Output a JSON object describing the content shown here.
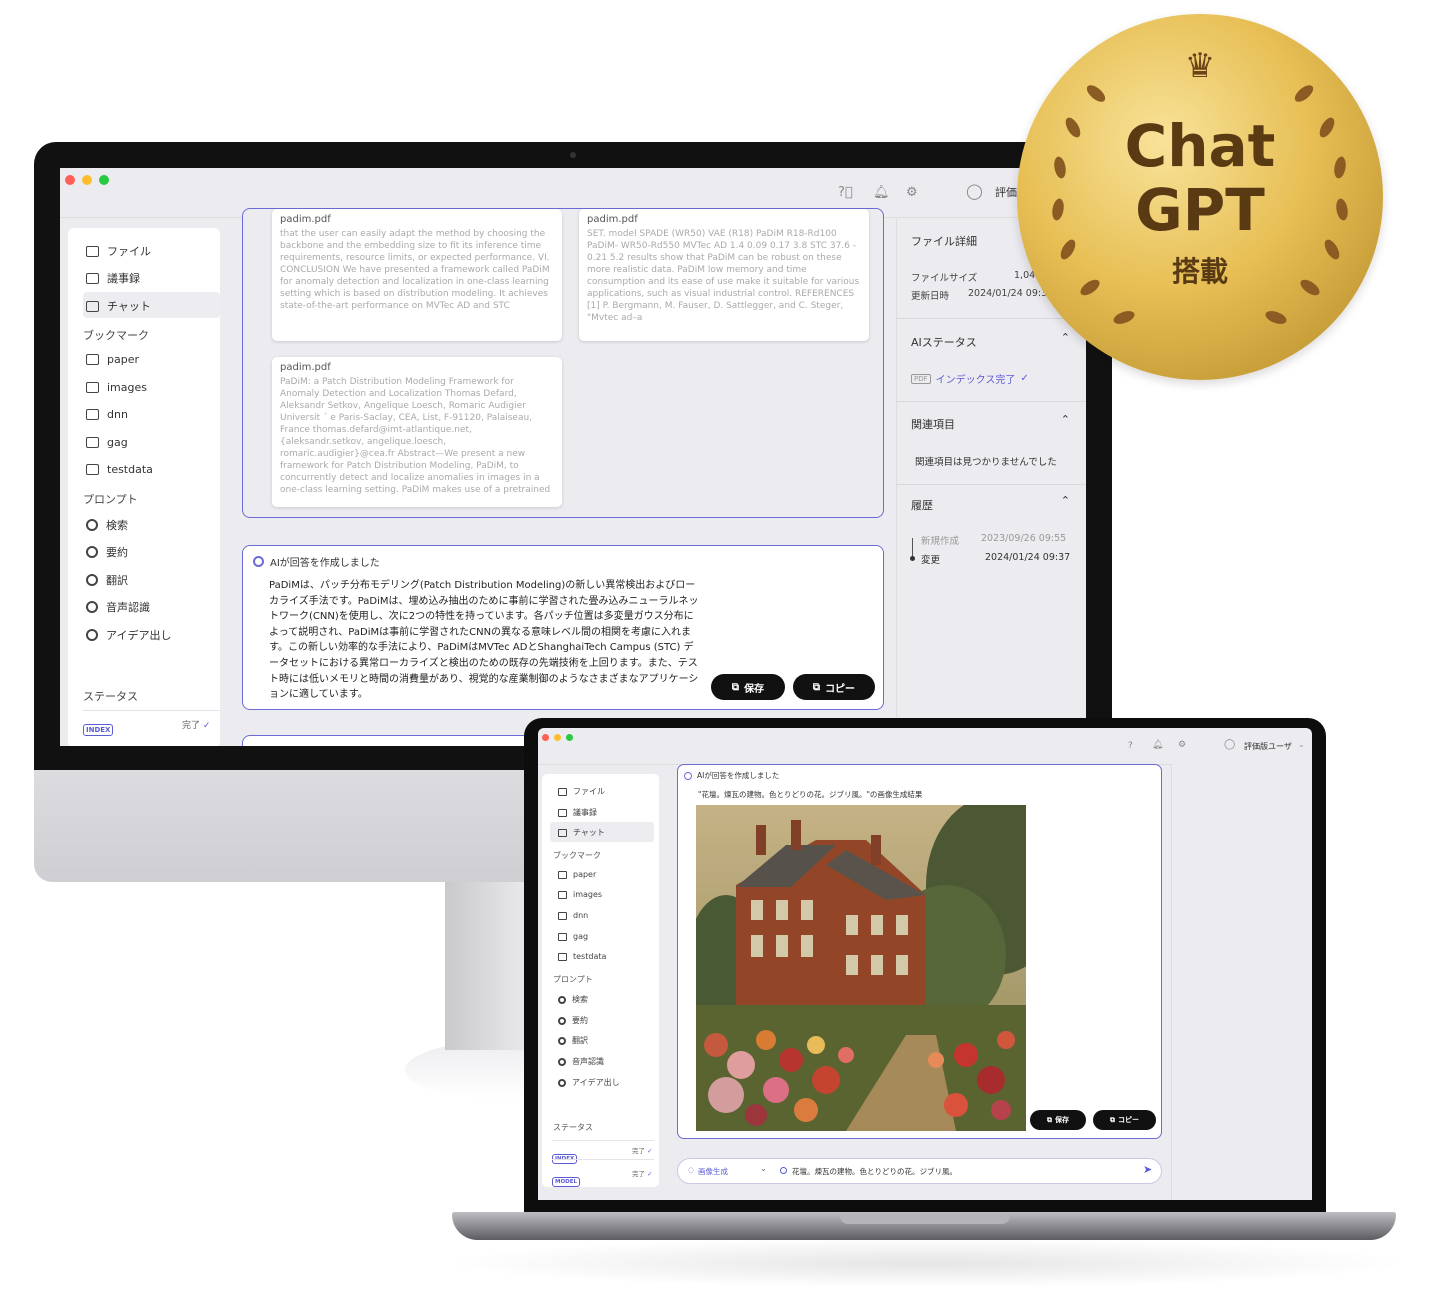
{
  "desktop": {
    "topbar": {
      "user_label": "評価版"
    },
    "sidebar": {
      "items": [
        {
          "label": "ファイル"
        },
        {
          "label": "議事録"
        },
        {
          "label": "チャット"
        }
      ],
      "bookmarks_heading": "ブックマーク",
      "bookmarks": [
        {
          "label": "paper"
        },
        {
          "label": "images"
        },
        {
          "label": "dnn"
        },
        {
          "label": "gag"
        },
        {
          "label": "testdata"
        }
      ],
      "prompts_heading": "プロンプト",
      "prompts": [
        {
          "label": "検索"
        },
        {
          "label": "要約"
        },
        {
          "label": "翻訳"
        },
        {
          "label": "音声認識"
        },
        {
          "label": "アイデア出し"
        }
      ],
      "status_heading": "ステータス",
      "status_index_badge": "INDEX",
      "status_index_value": "完了"
    },
    "results": [
      {
        "title": "padim.pdf",
        "text": "that the user can easily adapt the method by choosing the backbone and the embedding size to fit its inference time requirements, resource limits, or expected performance. VI. CONCLUSION We have presented a framework called PaDiM for anomaly detection and localization in one-class learning setting which is based on distribution modeling. It achieves state-of-the-art performance on MVTec AD and STC"
      },
      {
        "title": "padim.pdf",
        "text": "SET. model SPADE (WR50) VAE (R18) PaDiM R18-Rd100 PaDiM- WR50-Rd550 MVTec AD 1.4 0.09 0.17 3.8 STC 37.6 - 0.21 5.2 results show that PaDiM can be robust on these more realistic data. PaDiM low memory and time consumption and its ease of use make it suitable for various applications, such as visual industrial control. REFERENCES [1] P. Bergmann, M. Fauser, D. Sattlegger, and C. Steger, \"Mvtec ad–a"
      },
      {
        "title": "padim.pdf",
        "text": "PaDiM: a Patch Distribution Modeling Framework for Anomaly Detection and Localization Thomas Defard, Aleksandr Setkov, Angelique Loesch, Romaric Audigier Universit ´ e Paris-Saclay, CEA, List, F-91120, Palaiseau, France thomas.defard@imt-atlantique.net, {aleksandr.setkov, angelique.loesch, romaric.audigier}@cea.fr Abstract—We present a new framework for Patch Distribution Modeling, PaDiM, to concurrently detect and localize anomalies in images in a one-class learning setting. PaDiM makes use of a pretrained"
      }
    ],
    "answer": {
      "heading": "AIが回答を作成しました",
      "body": "PaDiMは、パッチ分布モデリング(Patch Distribution Modeling)の新しい異常検出およびローカライズ手法です。PaDiMは、埋め込み抽出のために事前に学習された畳み込みニューラルネットワーク(CNN)を使用し、次に2つの特性を持っています。各パッチ位置は多変量ガウス分布によって説明され、PaDiMは事前に学習されたCNNの異なる意味レベル間の相関を考慮に入れます。この新しい効率的な手法により、PaDiMはMVTec ADとShanghaiTech Campus (STC) データセットにおける異常ローカライズと検出のための既存の先端技術を上回ります。また、テスト時には低いメモリと時間の消費量があり、視覚的な産業制御のようなさまざまなアプリケーションに適しています。",
      "save_label": "保存",
      "copy_label": "コピー"
    },
    "right_panel": {
      "file_details_heading": "ファイル詳細",
      "file_size_label": "ファイルサイズ",
      "file_size_value": "1,04",
      "updated_label": "更新日時",
      "updated_value": "2024/01/24 09:3",
      "ai_status_heading": "AIステータス",
      "pdf_badge": "PDF",
      "index_status": "インデックス完了",
      "related_heading": "関連項目",
      "related_empty": "関連項目は見つかりませんでした",
      "history_heading": "履歴",
      "history": [
        {
          "label": "新規作成",
          "date": "2023/09/26 09:55"
        },
        {
          "label": "変更",
          "date": "2024/01/24 09:37"
        }
      ]
    }
  },
  "badge": {
    "line1": "Chat",
    "line2": "GPT",
    "line3": "搭載"
  },
  "laptop": {
    "topbar": {
      "user_label": "評価版ユーザ"
    },
    "sidebar": {
      "items": [
        {
          "label": "ファイル"
        },
        {
          "label": "議事録"
        },
        {
          "label": "チャット"
        }
      ],
      "bookmarks_heading": "ブックマーク",
      "bookmarks": [
        {
          "label": "paper"
        },
        {
          "label": "images"
        },
        {
          "label": "dnn"
        },
        {
          "label": "gag"
        },
        {
          "label": "testdata"
        }
      ],
      "prompts_heading": "プロンプト",
      "prompts": [
        {
          "label": "検索"
        },
        {
          "label": "要約"
        },
        {
          "label": "翻訳"
        },
        {
          "label": "音声認識"
        },
        {
          "label": "アイデア出し"
        }
      ],
      "status_heading": "ステータス",
      "status": [
        {
          "badge": "INDEX",
          "value": "完了"
        },
        {
          "badge": "MODEL",
          "value": "完了"
        }
      ]
    },
    "answer": {
      "heading": "AIが回答を作成しました",
      "caption": "\"花壇。煉瓦の建物。色とりどりの花。ジブリ風。\"の画像生成結果",
      "save_label": "保存",
      "copy_label": "コピー"
    },
    "input": {
      "mode": "画像生成",
      "value": "花壇。煉瓦の建物。色とりどりの花。ジブリ風。"
    }
  }
}
